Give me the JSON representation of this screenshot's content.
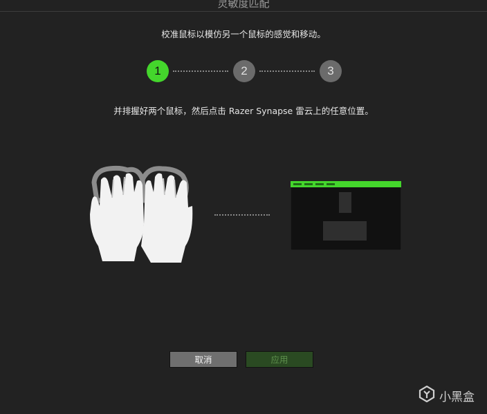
{
  "dialog": {
    "title": "灵敏度匹配",
    "subtitle": "校准鼠标以模仿另一个鼠标的感觉和移动。",
    "instruction": "并排握好两个鼠标，然后点击 Razer Synapse 雷云上的任意位置。"
  },
  "stepper": {
    "steps": [
      {
        "label": "1",
        "state": "active"
      },
      {
        "label": "2",
        "state": "pending"
      },
      {
        "label": "3",
        "state": "pending"
      }
    ]
  },
  "buttons": {
    "cancel_label": "取消",
    "apply_label": "应用"
  },
  "watermark": {
    "text": "小黑盒"
  },
  "colors": {
    "background": "#222222",
    "accent_green": "#44d62c",
    "step_inactive": "#6b6b6b",
    "apply_disabled": "#2a4a22"
  },
  "icons": {
    "hands": "hands-on-mice-illustration",
    "screen": "synapse-window-illustration",
    "logo": "xiaoheihe-logo-icon"
  }
}
